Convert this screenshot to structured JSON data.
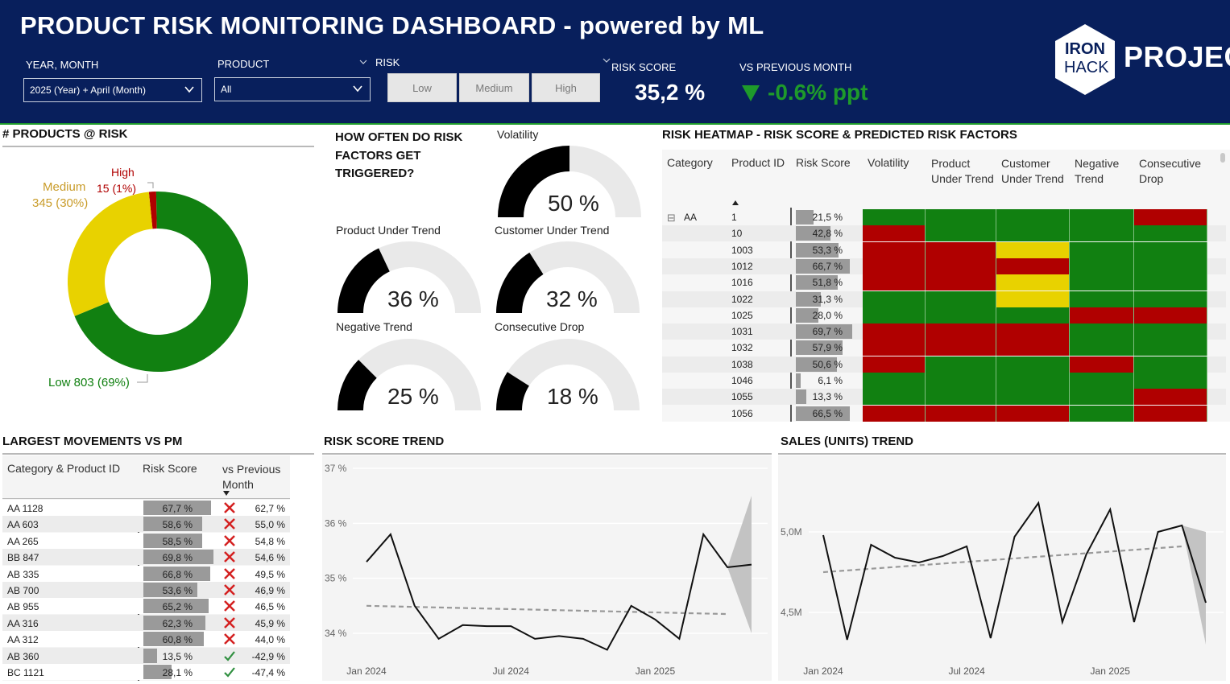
{
  "header": {
    "title": "PRODUCT RISK MONITORING DASHBOARD - powered by ML",
    "year_month_label": "YEAR, MONTH",
    "year_month_value": "2025 (Year) + April (Month)",
    "product_label": "PRODUCT",
    "product_value": "All",
    "risk_label": "RISK",
    "risk_buttons": [
      "Low",
      "Medium",
      "High"
    ],
    "risk_score_label": "RISK SCORE",
    "risk_score_value": "35,2 %",
    "vs_prev_label": "VS PREVIOUS MONTH",
    "vs_prev_value": "-0.6% ppt",
    "logo_line1": "IRON",
    "logo_line2": "HACK",
    "logo_project": "PROJECT"
  },
  "products_at_risk": {
    "title": "# PRODUCTS @ RISK",
    "low_label": "Low 803 (69%)",
    "medium_label": "Medium",
    "medium_value": "345 (30%)",
    "high_label": "High",
    "high_value": "15 (1%)",
    "colors": {
      "low": "#118011",
      "medium": "#e8d200",
      "high": "#b00000"
    }
  },
  "triggers": {
    "title_lines": [
      "HOW OFTEN DO RISK",
      "FACTORS GET",
      "TRIGGERED?"
    ],
    "gauges": [
      {
        "label": "Volatility",
        "value": "50 %",
        "fraction": 0.5
      },
      {
        "label": "Product Under Trend",
        "value": "36 %",
        "fraction": 0.36
      },
      {
        "label": "Customer Under Trend",
        "value": "32 %",
        "fraction": 0.32
      },
      {
        "label": "Negative Trend",
        "value": "25 %",
        "fraction": 0.25
      },
      {
        "label": "Consecutive Drop",
        "value": "18 %",
        "fraction": 0.18
      }
    ]
  },
  "heatmap": {
    "title": "RISK HEATMAP - RISK SCORE & PREDICTED RISK FACTORS",
    "headers": [
      "Category",
      "Product ID",
      "Risk Score",
      "Volatility",
      "Product Under Trend",
      "Customer Under Trend",
      "Negative Trend",
      "Consecutive Drop"
    ],
    "category": "AA",
    "collapse_glyph": "⊟",
    "rows": [
      {
        "id": "1",
        "score": "21,5 %",
        "pct": 21.5,
        "flags": [
          "g",
          "g",
          "g",
          "g",
          "r"
        ]
      },
      {
        "id": "10",
        "score": "42,8 %",
        "pct": 42.8,
        "flags": [
          "r",
          "g",
          "g",
          "g",
          "g"
        ]
      },
      {
        "id": "1003",
        "score": "53,3 %",
        "pct": 53.3,
        "flags": [
          "r",
          "r",
          "y",
          "g",
          "g"
        ]
      },
      {
        "id": "1012",
        "score": "66,7 %",
        "pct": 66.7,
        "flags": [
          "r",
          "r",
          "r",
          "g",
          "g"
        ]
      },
      {
        "id": "1016",
        "score": "51,8 %",
        "pct": 51.8,
        "flags": [
          "r",
          "r",
          "y",
          "g",
          "g"
        ]
      },
      {
        "id": "1022",
        "score": "31,3 %",
        "pct": 31.3,
        "flags": [
          "g",
          "g",
          "y",
          "g",
          "g"
        ]
      },
      {
        "id": "1025",
        "score": "28,0 %",
        "pct": 28.0,
        "flags": [
          "g",
          "g",
          "g",
          "r",
          "r"
        ]
      },
      {
        "id": "1031",
        "score": "69,7 %",
        "pct": 69.7,
        "flags": [
          "r",
          "r",
          "r",
          "g",
          "g"
        ]
      },
      {
        "id": "1032",
        "score": "57,9 %",
        "pct": 57.9,
        "flags": [
          "r",
          "r",
          "r",
          "g",
          "g"
        ]
      },
      {
        "id": "1038",
        "score": "50,6 %",
        "pct": 50.6,
        "flags": [
          "r",
          "g",
          "g",
          "r",
          "g"
        ]
      },
      {
        "id": "1046",
        "score": "6,1 %",
        "pct": 6.1,
        "flags": [
          "g",
          "g",
          "g",
          "g",
          "g"
        ]
      },
      {
        "id": "1055",
        "score": "13,3 %",
        "pct": 13.3,
        "flags": [
          "g",
          "g",
          "g",
          "g",
          "r"
        ]
      },
      {
        "id": "1056",
        "score": "66,5 %",
        "pct": 66.5,
        "flags": [
          "r",
          "r",
          "r",
          "g",
          "r"
        ]
      }
    ],
    "colors": {
      "g": "#118011",
      "r": "#b00000",
      "y": "#e8d200"
    }
  },
  "movements": {
    "title": "LARGEST MOVEMENTS VS PM",
    "headers": [
      "Category & Product ID",
      "Risk Score",
      "vs Previous Month"
    ],
    "rows": [
      {
        "id": "AA 1128",
        "score": "67,7 %",
        "pct": 67.7,
        "delta": "62,7 %",
        "up": true
      },
      {
        "id": "AA 603",
        "score": "58,6 %",
        "pct": 58.6,
        "delta": "55,0 %",
        "up": true
      },
      {
        "id": "AA 265",
        "score": "58,5 %",
        "pct": 58.5,
        "delta": "54,8 %",
        "up": true
      },
      {
        "id": "BB 847",
        "score": "69,8 %",
        "pct": 69.8,
        "delta": "54,6 %",
        "up": true
      },
      {
        "id": "AB 335",
        "score": "66,8 %",
        "pct": 66.8,
        "delta": "49,5 %",
        "up": true
      },
      {
        "id": "AB 700",
        "score": "53,6 %",
        "pct": 53.6,
        "delta": "46,9 %",
        "up": true
      },
      {
        "id": "AB 955",
        "score": "65,2 %",
        "pct": 65.2,
        "delta": "46,5 %",
        "up": true
      },
      {
        "id": "AA 316",
        "score": "62,3 %",
        "pct": 62.3,
        "delta": "45,9 %",
        "up": true
      },
      {
        "id": "AA 312",
        "score": "60,8 %",
        "pct": 60.8,
        "delta": "44,0 %",
        "up": true
      },
      {
        "id": "AB 360",
        "score": "13,5 %",
        "pct": 13.5,
        "delta": "-42,9 %",
        "up": false
      },
      {
        "id": "BC 1121",
        "score": "28,1 %",
        "pct": 28.1,
        "delta": "-47,4 %",
        "up": false
      }
    ]
  },
  "chart_data": [
    {
      "type": "line",
      "title": "RISK SCORE TREND",
      "x": [
        "2024-01",
        "2024-02",
        "2024-03",
        "2024-04",
        "2024-05",
        "2024-06",
        "2024-07",
        "2024-08",
        "2024-09",
        "2024-10",
        "2024-11",
        "2024-12",
        "2025-01",
        "2025-02",
        "2025-03",
        "2025-04"
      ],
      "series": [
        {
          "values": [
            35.3,
            35.8,
            34.5,
            33.9,
            34.15,
            34.13,
            34.13,
            33.9,
            33.95,
            33.9,
            33.7,
            34.5,
            34.25,
            33.9,
            35.8,
            35.2,
            35.25
          ]
        },
        {
          "values": [
            34.5,
            34.35
          ]
        }
      ],
      "trend": {
        "start": 34.5,
        "end": 34.35
      },
      "forecast_band": {
        "upper": 36.5,
        "lower": 34.0
      },
      "yticks": [
        "37 %",
        "36 %",
        "35 %",
        "34 %"
      ],
      "ylim": [
        33.9,
        37.0
      ],
      "xticks": [
        "Jan 2024",
        "Jul 2024",
        "Jan 2025"
      ]
    },
    {
      "type": "line",
      "title": "SALES (UNITS) TREND",
      "x": [
        "2024-01",
        "2024-02",
        "2024-03",
        "2024-04",
        "2024-05",
        "2024-06",
        "2024-07",
        "2024-08",
        "2024-09",
        "2024-10",
        "2024-11",
        "2024-12",
        "2025-01",
        "2025-02",
        "2025-03",
        "2025-04"
      ],
      "series": [
        {
          "values": [
            4.98,
            4.33,
            4.92,
            4.84,
            4.81,
            4.85,
            4.91,
            4.34,
            4.97,
            5.18,
            4.44,
            4.86,
            5.14,
            4.44,
            5.0,
            5.04,
            4.56
          ]
        }
      ],
      "trend": {
        "start": 4.75,
        "end": 4.91
      },
      "forecast_band": {
        "upper": 5.0,
        "lower": 4.3
      },
      "yticks": [
        "5,0M",
        "4,5M"
      ],
      "xticks": [
        "Jan 2024",
        "Jul 2024",
        "Jan 2025"
      ]
    }
  ]
}
